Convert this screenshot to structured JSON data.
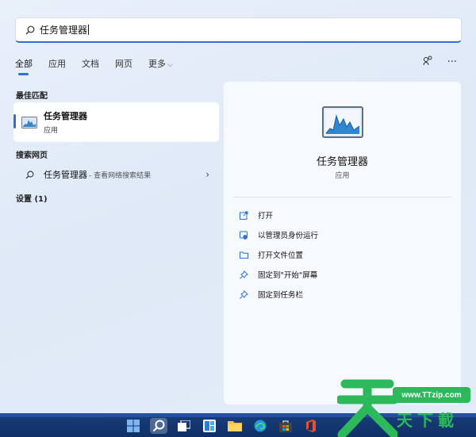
{
  "search": {
    "value": "任务管理器"
  },
  "tabs": [
    {
      "label": "全部"
    },
    {
      "label": "应用"
    },
    {
      "label": "文档"
    },
    {
      "label": "网页"
    },
    {
      "label": "更多"
    }
  ],
  "left": {
    "best_match_title": "最佳匹配",
    "best_match": {
      "name": "任务管理器",
      "type": "应用"
    },
    "web_title": "搜索网页",
    "web_item": {
      "term": "任务管理器",
      "suffix": "- 查看网络搜索结果"
    },
    "settings_title": "设置 (1)"
  },
  "right": {
    "title": "任务管理器",
    "subtitle": "应用",
    "actions": [
      {
        "label": "打开",
        "icon": "open-external-icon"
      },
      {
        "label": "以管理员身份运行",
        "icon": "shield-icon"
      },
      {
        "label": "打开文件位置",
        "icon": "folder-icon"
      },
      {
        "label": "固定到\"开始\"屏幕",
        "icon": "pin-icon"
      },
      {
        "label": "固定到任务栏",
        "icon": "pin-icon"
      }
    ]
  },
  "watermark": {
    "url": "www.TTzip.com",
    "chars": "天下載"
  },
  "colors": {
    "accent": "#2f6fd6",
    "taskbar": "#12356f",
    "watermark_green": "#2eb85c"
  }
}
